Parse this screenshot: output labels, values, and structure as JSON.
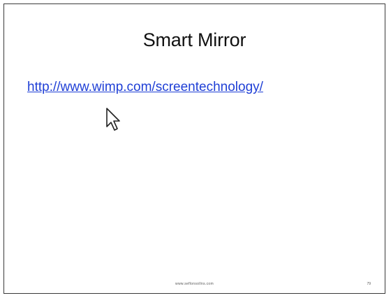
{
  "slide": {
    "title": "Smart Mirror",
    "link_text": "http://www.wimp.com/screentechnology/",
    "footer_text": "www.seflonsollns.com",
    "page_number": "79"
  },
  "icons": {
    "cursor": "arrow-pointer-icon"
  }
}
